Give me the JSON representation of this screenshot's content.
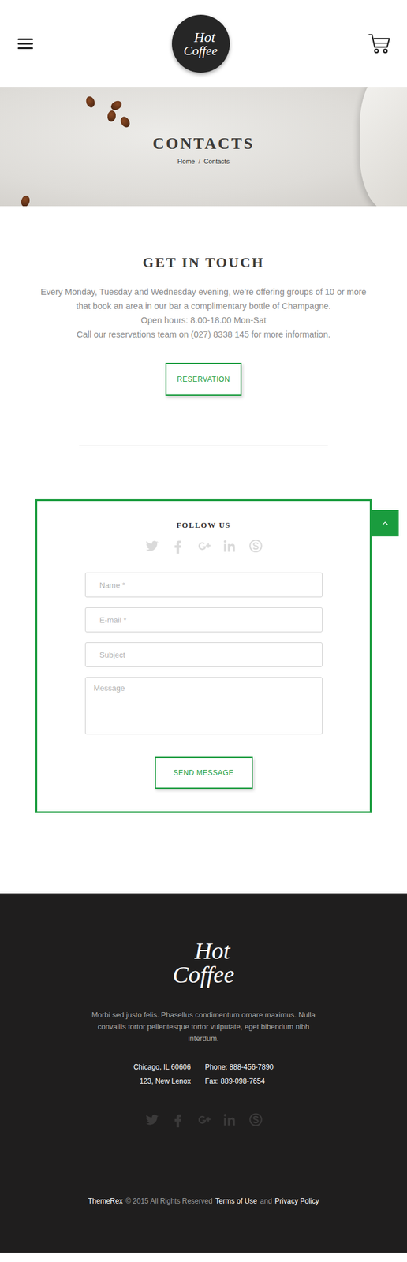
{
  "header": {
    "logo": {
      "line1": "Hot",
      "line2": "Coffee"
    }
  },
  "banner": {
    "title": "CONTACTS",
    "breadcrumbs": [
      {
        "label": "Home",
        "selected": false
      },
      {
        "label": "Contacts",
        "selected": true
      }
    ],
    "separator": "/"
  },
  "intro": {
    "title": "GET IN TOUCH",
    "lines": [
      "Every Monday, Tuesday and Wednesday evening, we’re offering groups of 10 or more that book an area in our bar a complimentary bottle of Champagne.",
      "Open hours: 8.00-18.00 Mon-Sat",
      "Call our reservations team on (027) 8338 145 for more information."
    ],
    "button": "RESERVATION"
  },
  "contact_form": {
    "title": "FOLLOW US",
    "fields": [
      {
        "placeholder": "Name *",
        "kind": "input"
      },
      {
        "placeholder": "E-mail *",
        "kind": "input"
      },
      {
        "placeholder": "Subject",
        "kind": "input"
      },
      {
        "placeholder": "Message",
        "kind": "textarea"
      }
    ],
    "button": "SEND MESSAGE"
  },
  "footer": {
    "logo": {
      "line1": "Hot",
      "line2": "Coffee"
    },
    "text": "Morbi sed justo felis. Phasellus condimentum ornare maximus. Nulla convallis tortor pellentesque tortor vulputate, eget bibendum nibh interdum.",
    "address": [
      "Chicago, IL 60606",
      "123, New Lenox"
    ],
    "contacts": [
      "Phone: 888-456-7890",
      "Fax: 889-098-7654"
    ],
    "copyright": {
      "brand": "ThemeRex",
      "rights": "© 2015 All Rights Reserved",
      "terms": "Terms of Use",
      "and": "and",
      "privacy": "Privacy Policy"
    }
  }
}
